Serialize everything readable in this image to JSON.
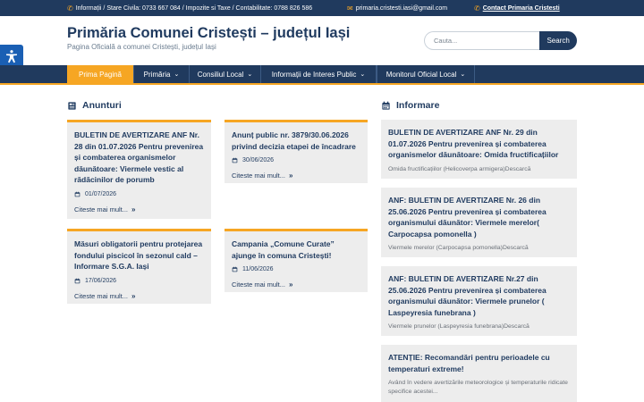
{
  "topbar": {
    "phone_text": "Informații / Stare Civila: 0733 667 084 / Impozite si Taxe / Contabilitate: 0788 826 586",
    "email": "primaria.cristesti.iasi@gmail.com",
    "contact_link": "Contact Primaria Cristesti"
  },
  "header": {
    "title": "Primăria Comunei Cristești – județul Iași",
    "tagline": "Pagina Oficială a comunei Cristești, județul Iași"
  },
  "search": {
    "placeholder": "Cauta...",
    "button": "Search"
  },
  "nav": {
    "items": [
      {
        "label": "Prima Pagină"
      },
      {
        "label": "Primăria"
      },
      {
        "label": "Consiliul Local"
      },
      {
        "label": "Informații de Interes Public"
      },
      {
        "label": "Monitorul Oficial Local"
      }
    ],
    "chevron": "⌄"
  },
  "anunturi": {
    "heading": "Anunturi",
    "more_label": "Citeste mai mult...",
    "cards": [
      {
        "title": "BULETIN DE AVERTIZARE ANF Nr. 28 din 01.07.2026 Pentru prevenirea și combaterea organismelor dăunătoare: Viermele vestic al rădăcinilor de porumb",
        "date": "01/07/2026"
      },
      {
        "title": "Anunț public nr. 3879/30.06.2026 privind decizia etapei de încadrare",
        "date": "30/06/2026"
      },
      {
        "title": "Măsuri obligatorii pentru protejarea fondului piscicol în sezonul cald – Informare S.G.A. Iași",
        "date": "17/06/2026"
      },
      {
        "title": "Campania „Comune Curate” ajunge în comuna Cristești!",
        "date": "11/06/2026"
      }
    ]
  },
  "informare": {
    "heading": "Informare",
    "items": [
      {
        "title": "BULETIN DE AVERTIZARE ANF Nr. 29 din 01.07.2026 Pentru prevenirea și combaterea organismelor dăunătoare: Omida fructificațiilor",
        "excerpt": "Omida fructificațiilor (Helicoverpa armigera)Descarcă"
      },
      {
        "title": "ANF: BULETIN DE AVERTIZARE Nr. 26 din 25.06.2026 Pentru prevenirea și combaterea organismului dăunător: Viermele merelor( Carpocapsa pomonella )",
        "excerpt": "Viermele merelor (Carpocapsa pomonella)Descarcă"
      },
      {
        "title": "ANF: BULETIN DE AVERTIZARE Nr.27 din 25.06.2026 Pentru prevenirea și combaterea organismului dăunător: Viermele prunelor ( Laspeyresia funebrana )",
        "excerpt": "Viermele prunelor (Laspeyresia funebrana)Descarcă"
      },
      {
        "title": "ATENȚIE: Recomandări pentru perioadele cu temperaturi extreme!",
        "excerpt": "Având în vedere avertizările meteorologice și temperaturile ridicate specifice acestei..."
      }
    ]
  },
  "colors": {
    "navy": "#203a5e",
    "accent": "#f6a623",
    "card_bg": "#ededed",
    "a11y": "#1a5fb4"
  }
}
